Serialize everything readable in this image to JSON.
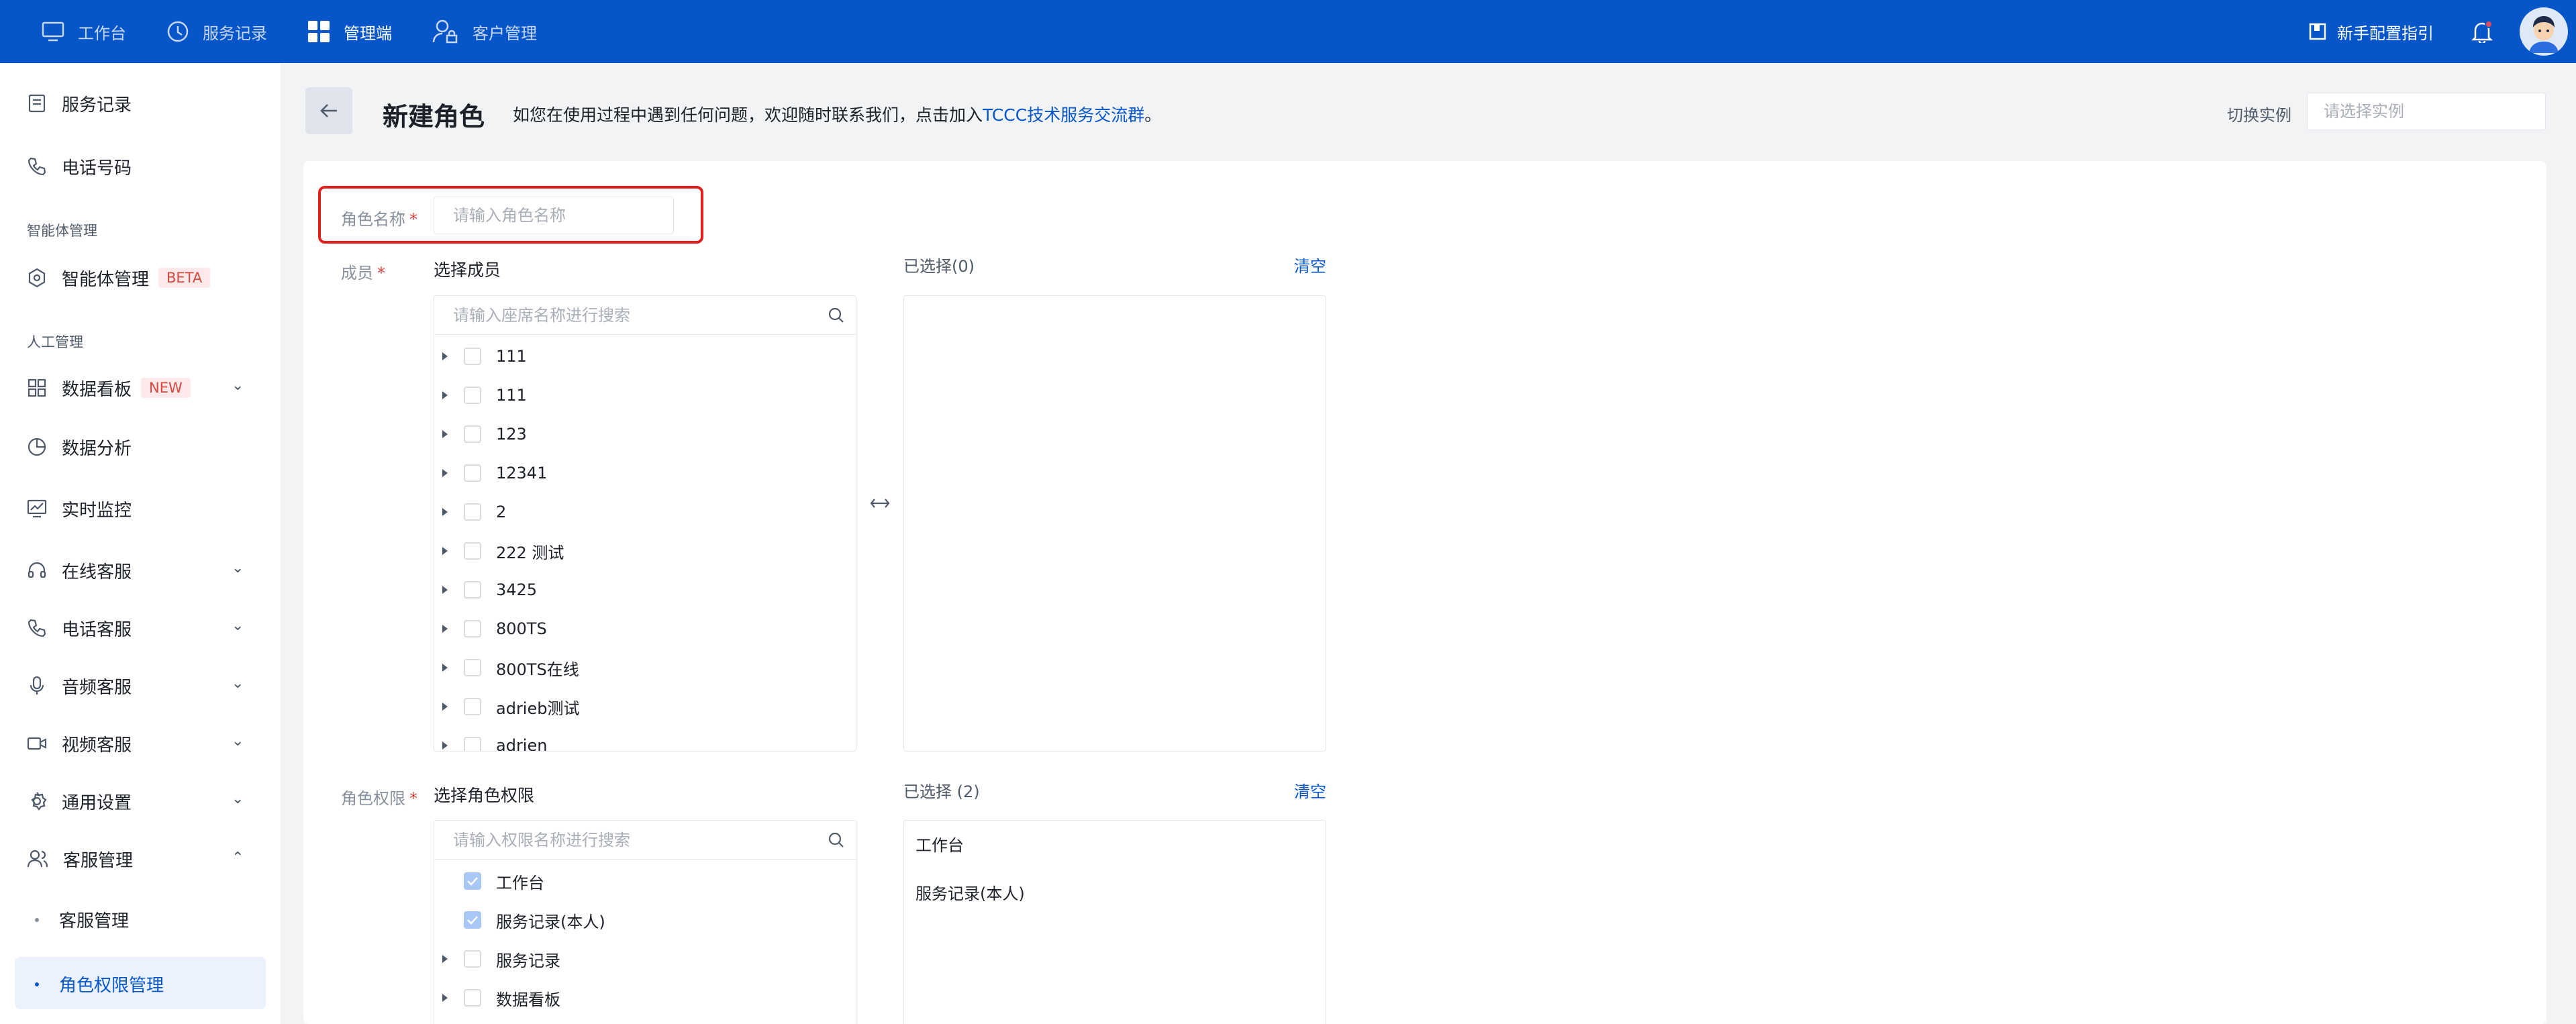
{
  "topnav": {
    "items": [
      {
        "label": "工作台",
        "icon": "monitor-icon",
        "active": false
      },
      {
        "label": "服务记录",
        "icon": "clock-icon",
        "active": false
      },
      {
        "label": "管理端",
        "icon": "grid-icon",
        "active": true
      },
      {
        "label": "客户管理",
        "icon": "user-lock-icon",
        "active": false
      }
    ],
    "guide_label": "新手配置指引"
  },
  "sidebar": {
    "items": [
      {
        "label": "服务记录",
        "icon": "document-icon"
      },
      {
        "label": "电话号码",
        "icon": "phone-icon"
      }
    ],
    "group_agent": "智能体管理",
    "agent_item": {
      "label": "智能体管理",
      "badge": "BETA",
      "icon": "hexagon-gear-icon"
    },
    "group_manual": "人工管理",
    "manual_items": [
      {
        "label": "数据看板",
        "badge": "NEW",
        "icon": "dashboard-icon",
        "expand": "down"
      },
      {
        "label": "数据分析",
        "icon": "pie-icon"
      },
      {
        "label": "实时监控",
        "icon": "monitor-chart-icon"
      },
      {
        "label": "在线客服",
        "icon": "headset-icon",
        "expand": "down"
      },
      {
        "label": "电话客服",
        "icon": "phone-icon",
        "expand": "down"
      },
      {
        "label": "音频客服",
        "icon": "microphone-icon",
        "expand": "down"
      },
      {
        "label": "视频客服",
        "icon": "video-icon",
        "expand": "down"
      },
      {
        "label": "通用设置",
        "icon": "gear-icon",
        "expand": "down"
      },
      {
        "label": "客服管理",
        "icon": "users-icon",
        "expand": "up"
      }
    ],
    "sub_items": [
      {
        "label": "客服管理",
        "active": false
      },
      {
        "label": "角色权限管理",
        "active": true
      }
    ]
  },
  "header": {
    "title": "新建角色",
    "hint_prefix": "如您在使用过程中遇到任何问题，欢迎随时联系我们，点击加入",
    "hint_link": "TCCC技术服务交流群",
    "hint_suffix": "。",
    "switch_label": "切换实例",
    "switch_placeholder": "请选择实例"
  },
  "form": {
    "name_label": "角色名称",
    "name_placeholder": "请输入角色名称",
    "required_mark": "*",
    "members": {
      "label": "成员",
      "select_title": "选择成员",
      "search_placeholder": "请输入座席名称进行搜索",
      "items": [
        "111",
        "111",
        "123",
        "12341",
        "2",
        "222 测试",
        "3425",
        "800TS",
        "800TS在线",
        "adrieb测试",
        "adrien"
      ],
      "chosen_title": "已选择(0)",
      "clear_label": "清空",
      "chosen": []
    },
    "perms": {
      "label": "角色权限",
      "select_title": "选择角色权限",
      "search_placeholder": "请输入权限名称进行搜索",
      "items": [
        {
          "label": "工作台",
          "checked": true,
          "expandable": false
        },
        {
          "label": "服务记录(本人)",
          "checked": true,
          "expandable": false
        },
        {
          "label": "服务记录",
          "checked": false,
          "expandable": true
        },
        {
          "label": "数据看板",
          "checked": false,
          "expandable": true
        }
      ],
      "chosen_title": "已选择 (2)",
      "clear_label": "清空",
      "chosen": [
        "工作台",
        "服务记录(本人)"
      ]
    }
  },
  "colors": {
    "brand": "#0656c9",
    "required": "#d54941",
    "highlight": "#e01e1e"
  }
}
